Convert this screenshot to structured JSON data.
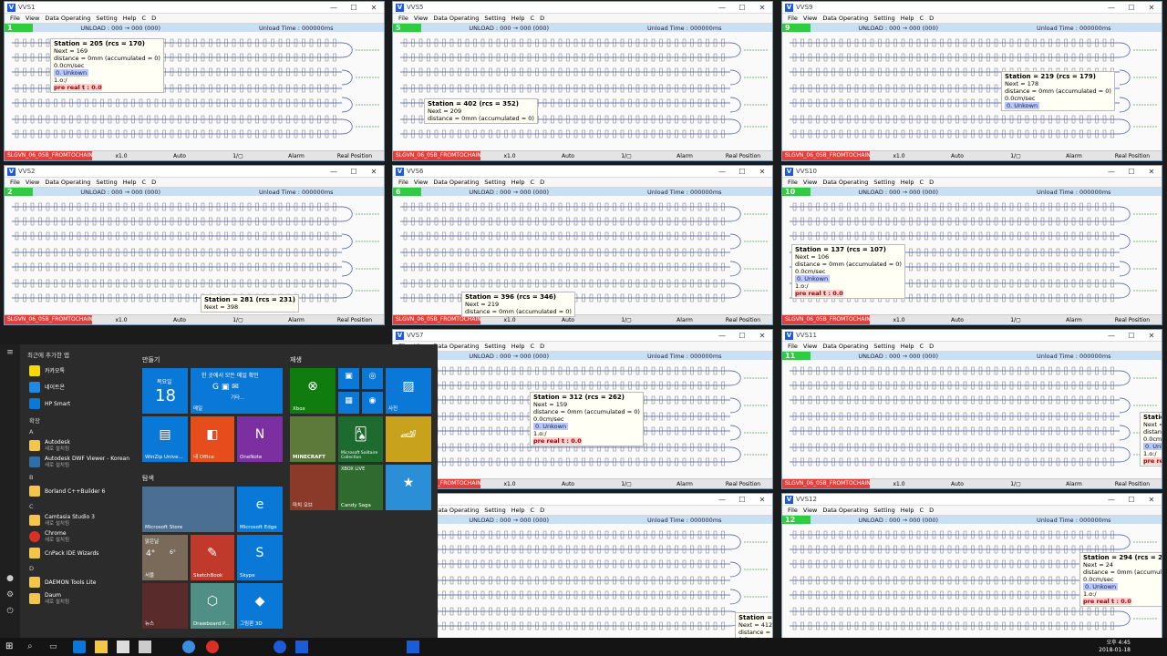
{
  "windows": [
    {
      "title": "VVS1",
      "num": "1",
      "pos": "a"
    },
    {
      "title": "VVS5",
      "num": "5",
      "pos": "b"
    },
    {
      "title": "VVS9",
      "num": "9",
      "pos": "c"
    },
    {
      "title": "VVS2",
      "num": "2",
      "pos": "d"
    },
    {
      "title": "VVS6",
      "num": "6",
      "pos": "e"
    },
    {
      "title": "VVS10",
      "num": "10",
      "pos": "f"
    },
    {
      "title": "VVS7",
      "num": "7",
      "pos": "h"
    },
    {
      "title": "VVS11",
      "num": "11",
      "pos": "i"
    },
    {
      "title": "",
      "num": "",
      "pos": "k"
    },
    {
      "title": "VVS12",
      "num": "12",
      "pos": "l"
    }
  ],
  "menu": {
    "file": "File",
    "view": "View",
    "data": "Data Operating",
    "setting": "Setting",
    "help": "Help",
    "c": "C",
    "d": "D"
  },
  "unload": "UNLOAD : 000 → 000 (000)",
  "unload_time": "Unload Time : 000000ms",
  "status": {
    "chain": "SLGVN_06_05B_FROMTOCHAIN",
    "scale": "x1.0",
    "auto": "Auto",
    "page": "1/▢",
    "alarm": "Alarm",
    "real": "Real Position"
  },
  "tooltips": {
    "w1": {
      "station": "Station = 205 (rcs = 170)",
      "next": "Next = 169",
      "dist": "distance = 0mm (accumulated = 0)",
      "speed": "0.0cm/sec",
      "unk": "0. Unkown",
      "ok": "1.o:/",
      "pre": "pre real t : 0.0"
    },
    "w5": {
      "station": "Station = 402 (rcs = 352)",
      "next": "Next = 209",
      "dist": "distance = 0mm (accumulated = 0)"
    },
    "w9": {
      "station": "Station = 219 (rcs = 179)",
      "next": "Next = 178",
      "dist": "distance = 0mm (accumulated = 0)",
      "speed": "0.0cm/sec",
      "unk": "0. Unkown"
    },
    "w2": {
      "station": "Station = 281 (rcs = 231)",
      "next": "Next = 398"
    },
    "w6": {
      "station": "Station = 396 (rcs = 346)",
      "next": "Next = 219",
      "dist": "distance = 0mm (accumulated = 0)"
    },
    "w10": {
      "station": "Station = 137 (rcs = 107)",
      "next": "Next = 106",
      "dist": "distance = 0mm (accumulated = 0)",
      "speed": "0.0cm/sec",
      "unk": "0. Unkown",
      "ok": "1.o:/",
      "pre": "pre real t : 0.0"
    },
    "w7": {
      "station": "Station = 312 (rcs = 262)",
      "next": "Next = 159",
      "dist": "distance = 0mm (accumulated = 0)",
      "speed": "0.0cm/sec",
      "unk": "0. Unkown",
      "ok": "1.o:/",
      "pre": "pre real t : 0.0"
    },
    "w11": {
      "station": "Station =",
      "next": "Next =",
      "dist": "distance =",
      "speed": "0.0cm/se",
      "unk": "0. Unkow",
      "ok": "1.o:/",
      "pre": "pre real"
    },
    "wk": {
      "station": "Station =",
      "next": "Next = 412",
      "dist": "distance =",
      "speed": "0.0cm/sec"
    },
    "w12": {
      "station": "Station = 294 (rcs = 244",
      "next": "Next = 24",
      "dist": "distance = 0mm (accumulated",
      "speed": "0.0cm/sec",
      "unk": "0. Unkown",
      "ok": "1.o:/",
      "pre": "pre real t : 0.0"
    }
  },
  "start": {
    "recent": "최근에 추가한 앱",
    "pinned_apps": [
      "카카오톡",
      "네이트온",
      "HP Smart"
    ],
    "expand": "확장",
    "letters": {
      "a": "A",
      "b": "B",
      "c": "C",
      "d": "D"
    },
    "apps": [
      {
        "name": "Autodesk",
        "sub": "새로 설치됨"
      },
      {
        "name": "Autodesk DWF Viewer - Korean",
        "sub": "새로 설치됨"
      },
      {
        "name": "Borland C++Builder 6",
        "sub": ""
      },
      {
        "name": "Camtasia Studio 3",
        "sub": "새로 설치됨"
      },
      {
        "name": "Chrome",
        "sub": "새로 설치됨"
      },
      {
        "name": "CnPack IDE Wizards",
        "sub": ""
      },
      {
        "name": "DAEMON Tools Lite",
        "sub": "새로 설치됨"
      },
      {
        "name": "Daum",
        "sub": "새로 설치됨"
      }
    ],
    "groups": {
      "make": "만들기",
      "play": "재생",
      "explore": "탐색"
    },
    "tiles": {
      "cal_day": "목요일",
      "cal_num": "18",
      "mail_title": "한 곳에서 모든 메일 확인",
      "mail_label": "메일",
      "mail_more": "기타...",
      "winzip": "WinZip Unive...",
      "office": "내 Office",
      "onenote": "OneNote",
      "xbox": "Xbox",
      "photos": "사진",
      "minecraft": "MINECRAFT",
      "solitaire": "Microsoft Solitaire Collection",
      "asphalt": "",
      "store": "Microsoft Store",
      "edge": "Microsoft Edge",
      "weather_city": "서울",
      "weather_temp": "4°",
      "weather_lo": "6°",
      "weather_label": "맑은날",
      "sketch": "SketchBook",
      "skype": "Skype",
      "news": "뉴스",
      "drawboard": "Drawboard P...",
      "paint3d": "그림판 3D",
      "xboxlive": "XBOX LIVE",
      "march": "마치 오브",
      "castle": "Candy Saga",
      "ka": ""
    }
  },
  "taskbar": {
    "time": "오후 4:45",
    "date": "2018-01-18"
  },
  "colors": {
    "accent": "#2ecc40",
    "chain": "#e0403a",
    "info": "#c9dff4"
  }
}
